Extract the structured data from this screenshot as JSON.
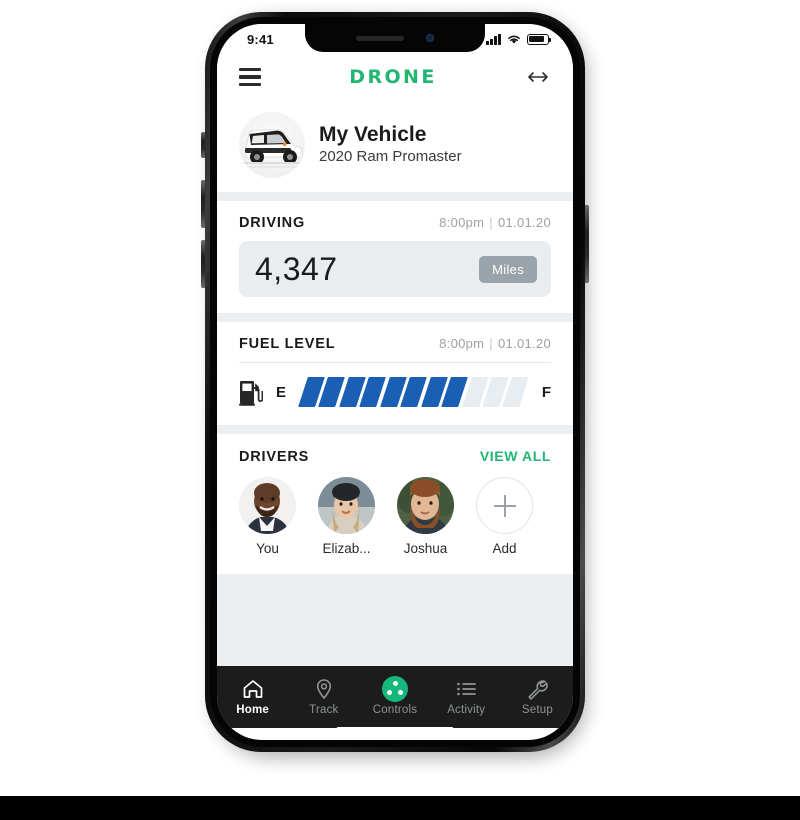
{
  "colors": {
    "brand_green": "#22b573",
    "accent_green": "#17b67a",
    "fuel_fill": "#1b5fb4",
    "fuel_empty": "#e8edf1",
    "badge_gray": "#9aa3aa",
    "page_bg": "#eceff1",
    "tabbar_bg": "#1c1c1c"
  },
  "status_bar": {
    "time": "9:41",
    "signal_icon": "cellular-signal-icon",
    "wifi_icon": "wifi-icon",
    "battery_icon": "battery-icon",
    "battery_level": 82
  },
  "app_bar": {
    "menu_icon": "hamburger-menu-icon",
    "brand": "DRONE",
    "expand_icon": "left-right-arrow-icon"
  },
  "vehicle": {
    "thumbnail_icon": "vehicle-photo",
    "name": "My Vehicle",
    "model": "2020 Ram Promaster"
  },
  "driving": {
    "title": "DRIVING",
    "time": "8:00pm",
    "separator": "|",
    "date": "01.01.20",
    "odometer": "4,347",
    "unit": "Miles"
  },
  "fuel": {
    "title": "FUEL LEVEL",
    "time": "8:00pm",
    "separator": "|",
    "date": "01.01.20",
    "pump_icon": "fuel-pump-icon",
    "empty_label": "E",
    "full_label": "F",
    "total_ticks": 11,
    "filled_ticks": 8
  },
  "drivers": {
    "title": "DRIVERS",
    "view_all": "VIEW ALL",
    "items": [
      {
        "name": "You",
        "avatar": "avatar-you"
      },
      {
        "name": "Elizab...",
        "avatar": "avatar-elizabeth"
      },
      {
        "name": "Joshua",
        "avatar": "avatar-joshua"
      },
      {
        "name": "Add",
        "avatar": "plus-icon"
      }
    ]
  },
  "tabbar": {
    "items": [
      {
        "label": "Home",
        "icon": "home-icon",
        "active": true
      },
      {
        "label": "Track",
        "icon": "map-pin-icon",
        "active": false
      },
      {
        "label": "Controls",
        "icon": "controls-dots-icon",
        "active": false
      },
      {
        "label": "Activity",
        "icon": "list-icon",
        "active": false
      },
      {
        "label": "Setup",
        "icon": "wrench-icon",
        "active": false
      }
    ]
  }
}
